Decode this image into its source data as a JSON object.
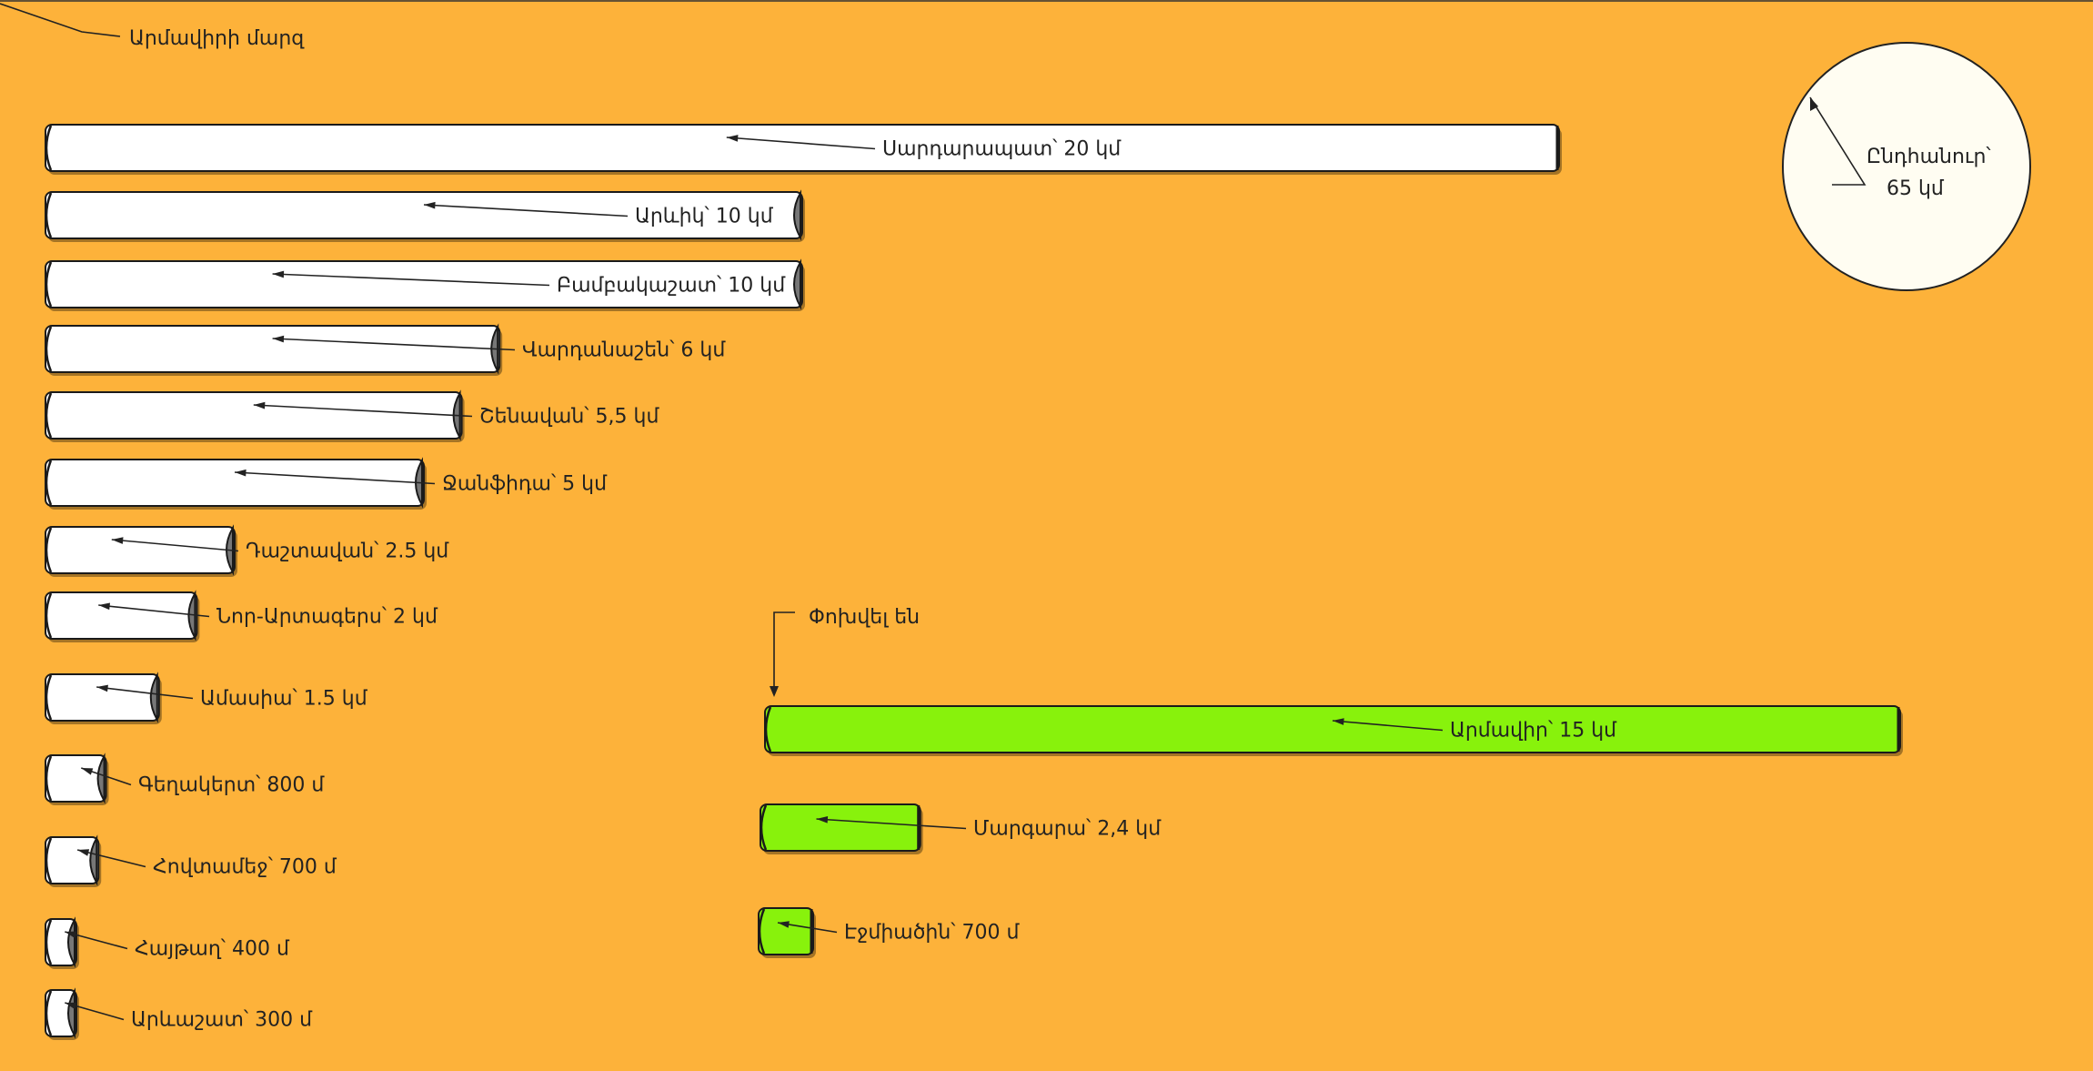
{
  "title": "Արմավիրի մարզ",
  "total": {
    "line1": "Ընդհանուր՝",
    "line2": "65 կմ",
    "km": 65
  },
  "moved_label": "Փոխվել են",
  "colors": {
    "background": "#FDB23A",
    "pipe_white": "#FFFFFF",
    "pipe_green": "#88F20C",
    "circle": "#FFFDF2",
    "outline": "#1A1A1A",
    "end_cap": "#777777"
  },
  "white_pipes": [
    {
      "label": "Սարդարապատ՝ 20 կմ",
      "km": 20
    },
    {
      "label": "Արևիկ՝ 10 կմ",
      "km": 10
    },
    {
      "label": "Բամբակաշատ՝ 10 կմ",
      "km": 10
    },
    {
      "label": "Վարդանաշեն՝ 6 կմ",
      "km": 6
    },
    {
      "label": "Շենավան՝ 5,5 կմ",
      "km": 5.5
    },
    {
      "label": "Ջանֆիդա՝ 5 կմ",
      "km": 5
    },
    {
      "label": "Դաշտավան՝ 2.5 կմ",
      "km": 2.5
    },
    {
      "label": "Նոր-Արտագերս՝ 2 կմ",
      "km": 2
    },
    {
      "label": "Ամասիա՝ 1.5 կմ",
      "km": 1.5
    },
    {
      "label": "Գեղակերտ՝ 800 մ",
      "km": 0.8
    },
    {
      "label": "Հովտամեջ՝ 700 մ",
      "km": 0.7
    },
    {
      "label": "Հայթաղ՝ 400 մ",
      "km": 0.4
    },
    {
      "label": "Արևաշատ՝ 300 մ",
      "km": 0.3
    }
  ],
  "green_pipes": [
    {
      "label": "Արմավիր՝ 15 կմ",
      "km": 15
    },
    {
      "label": "Մարգարա՝ 2,4 կմ",
      "km": 2.4
    },
    {
      "label": "Էջմիածին՝ 700 մ",
      "km": 0.7
    }
  ]
}
